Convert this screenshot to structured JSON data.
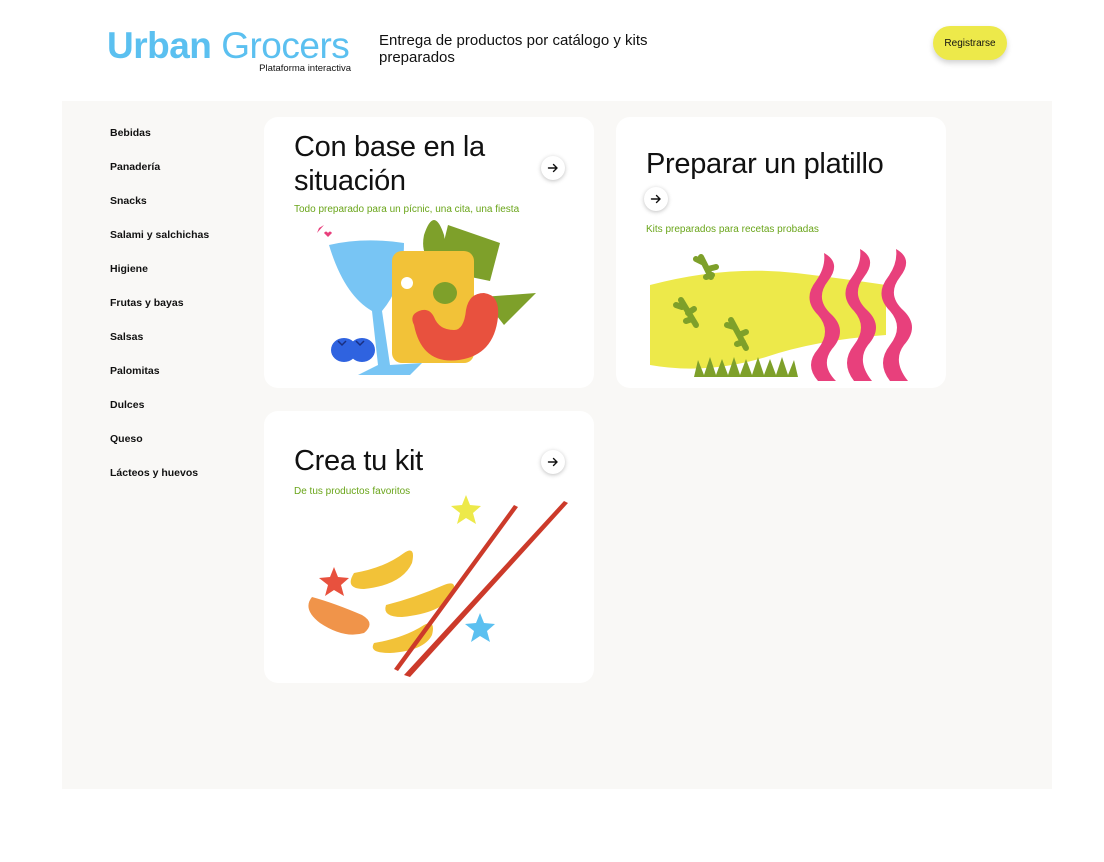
{
  "header": {
    "logo_word1": "Urban",
    "logo_word2": "Grocers",
    "logo_subtitle": "Plataforma interactiva",
    "tagline": "Entrega de productos por catálogo y kits preparados",
    "register_label": "Registrarse"
  },
  "sidebar": {
    "items": [
      {
        "label": "Bebidas"
      },
      {
        "label": "Panadería"
      },
      {
        "label": "Snacks"
      },
      {
        "label": "Salami y salchichas"
      },
      {
        "label": "Higiene"
      },
      {
        "label": "Frutas y bayas"
      },
      {
        "label": "Salsas"
      },
      {
        "label": "Palomitas"
      },
      {
        "label": "Dulces"
      },
      {
        "label": "Queso"
      },
      {
        "label": "Lácteos y huevos"
      }
    ]
  },
  "cards": [
    {
      "title": "Con base en la situación",
      "subtitle": "Todo preparado para un pícnic, una cita, una fiesta",
      "icon": "arrow-right-icon"
    },
    {
      "title": "Preparar un platillo",
      "subtitle": "Kits preparados para recetas probadas",
      "icon": "arrow-right-icon"
    },
    {
      "title": "Crea tu kit",
      "subtitle": "De tus productos favoritos",
      "icon": "arrow-right-icon"
    }
  ],
  "colors": {
    "brand_blue": "#5bc0f0",
    "accent_yellow": "#ede94a",
    "subtitle_green": "#6aa51a",
    "panel_bg": "#f9f8f6"
  }
}
